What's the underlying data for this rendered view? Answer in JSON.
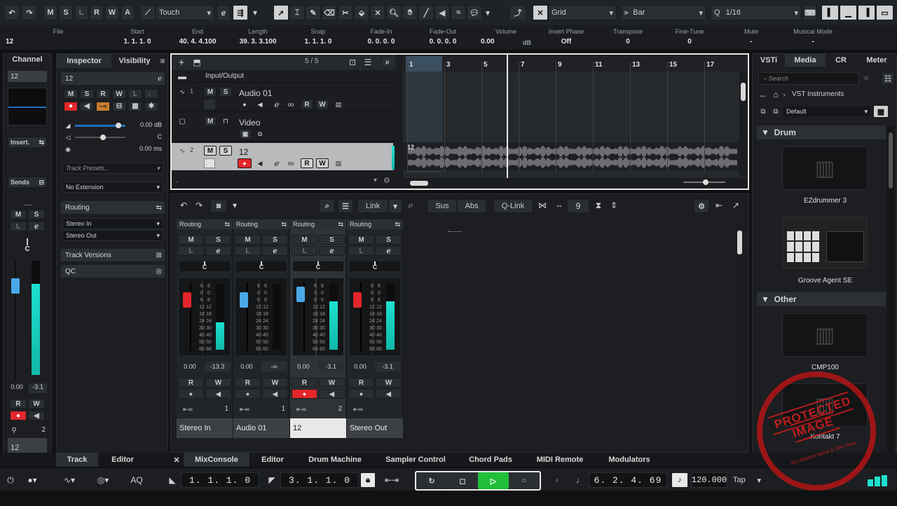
{
  "toolbar": {
    "mode_letters": [
      "M",
      "S",
      "L",
      "R",
      "W",
      "A"
    ],
    "automation_mode": "Touch",
    "snap_type": "Grid",
    "grid_type": "Bar",
    "quantize": "1/16"
  },
  "infoline": {
    "fields": [
      {
        "label": "File",
        "value": "12"
      },
      {
        "label": "Start",
        "value": "1. 1. 1.   0"
      },
      {
        "label": "End",
        "value": "40. 4. 4.100"
      },
      {
        "label": "Length",
        "value": "39. 3. 3.100"
      },
      {
        "label": "Snap",
        "value": "1. 1. 1.   0"
      },
      {
        "label": "Fade-In",
        "value": "0. 0. 0.   0"
      },
      {
        "label": "Fade-Out",
        "value": "0. 0. 0.   0"
      },
      {
        "label": "Volume",
        "value": "0.00"
      },
      {
        "label": "Invert Phase",
        "value": "Off"
      },
      {
        "label": "Transpose",
        "value": "0"
      },
      {
        "label": "Fine-Tune",
        "value": "0"
      },
      {
        "label": "Mute",
        "value": "-"
      },
      {
        "label": "Musical Mode",
        "value": "-"
      }
    ],
    "volume_unit": "dB"
  },
  "channel": {
    "title": "Channel",
    "track_name": "12",
    "insert_label": "Insert.",
    "sends_label": "Sends",
    "pan_value": "C",
    "vol_value": "0.00",
    "peak_value": "-3.1",
    "num": "2",
    "name": "12",
    "meter_level": 0.8
  },
  "inspector": {
    "tabs": [
      "Inspector",
      "Visibility"
    ],
    "track_name": "12",
    "volume": "0.00 dB",
    "pan": "C",
    "delay": "0.00 ms",
    "track_presets": "Track Presets...",
    "extension": "No Extension",
    "routing": "Routing",
    "stereo_in": "Stereo In",
    "stereo_out": "Stereo Out",
    "track_versions": "Track Versions",
    "qc": "QC"
  },
  "project": {
    "track_count": "5 / 5",
    "folder": "Input/Output",
    "tracks": [
      {
        "num": "1",
        "name": "Audio 01"
      },
      {
        "num": "",
        "name": "Video"
      },
      {
        "num": "2",
        "name": "12"
      }
    ],
    "ruler": [
      "1",
      "3",
      "5",
      "7",
      "9",
      "11",
      "13",
      "15",
      "17"
    ],
    "event_name": "12"
  },
  "mixer": {
    "link": "Link",
    "sus": "Sus",
    "abs": "Abs",
    "qlink": "Q-Link",
    "zoom": "9",
    "routing": "Routing",
    "scale": [
      "6",
      "0",
      "6",
      "12",
      "18",
      "24",
      "30",
      "40",
      "50",
      "60"
    ],
    "strips": [
      {
        "name": "Stereo In",
        "vol": "0.00",
        "peak": "-13.3",
        "num": "1",
        "meter": 0.42,
        "fader_color": "#e2262b"
      },
      {
        "name": "Audio 01",
        "vol": "0.00",
        "peak": "-∞",
        "num": "1",
        "meter": 0.0,
        "fader_color": "#4aa8e8"
      },
      {
        "name": "12",
        "vol": "0.00",
        "peak": "-3.1",
        "num": "2",
        "meter": 0.73,
        "fader_color": "#4aa8e8"
      },
      {
        "name": "Stereo Out",
        "vol": "0.00",
        "peak": "-3.1",
        "num": "",
        "meter": 0.73,
        "fader_color": "#e2262b"
      }
    ]
  },
  "right": {
    "tabs": [
      "VSTi",
      "Media",
      "CR",
      "Meter"
    ],
    "search_placeholder": "Search",
    "path": "VST Instruments",
    "preset": "Default",
    "cat1": "Drum",
    "cat2": "Other",
    "instruments": [
      "EZdrummer 3",
      "Groove Agent SE",
      "CMP100",
      "Kontakt 7"
    ]
  },
  "bottom": {
    "left_tabs": [
      "Track",
      "Editor"
    ],
    "tabs": [
      "MixConsole",
      "Editor",
      "Drum Machine",
      "Sampler Control",
      "Chord Pads",
      "MIDI Remote",
      "Modulators"
    ]
  },
  "transport": {
    "aq": "AQ",
    "left_locator": "1. 1. 1.   0",
    "right_locator": "3. 1. 1.   0",
    "position": "6. 2. 4.  69",
    "tempo": "120.000",
    "tap": "Tap"
  },
  "watermark": {
    "text": "PROTECTED IMAGE",
    "sub": "My Website Name & URL Here"
  }
}
